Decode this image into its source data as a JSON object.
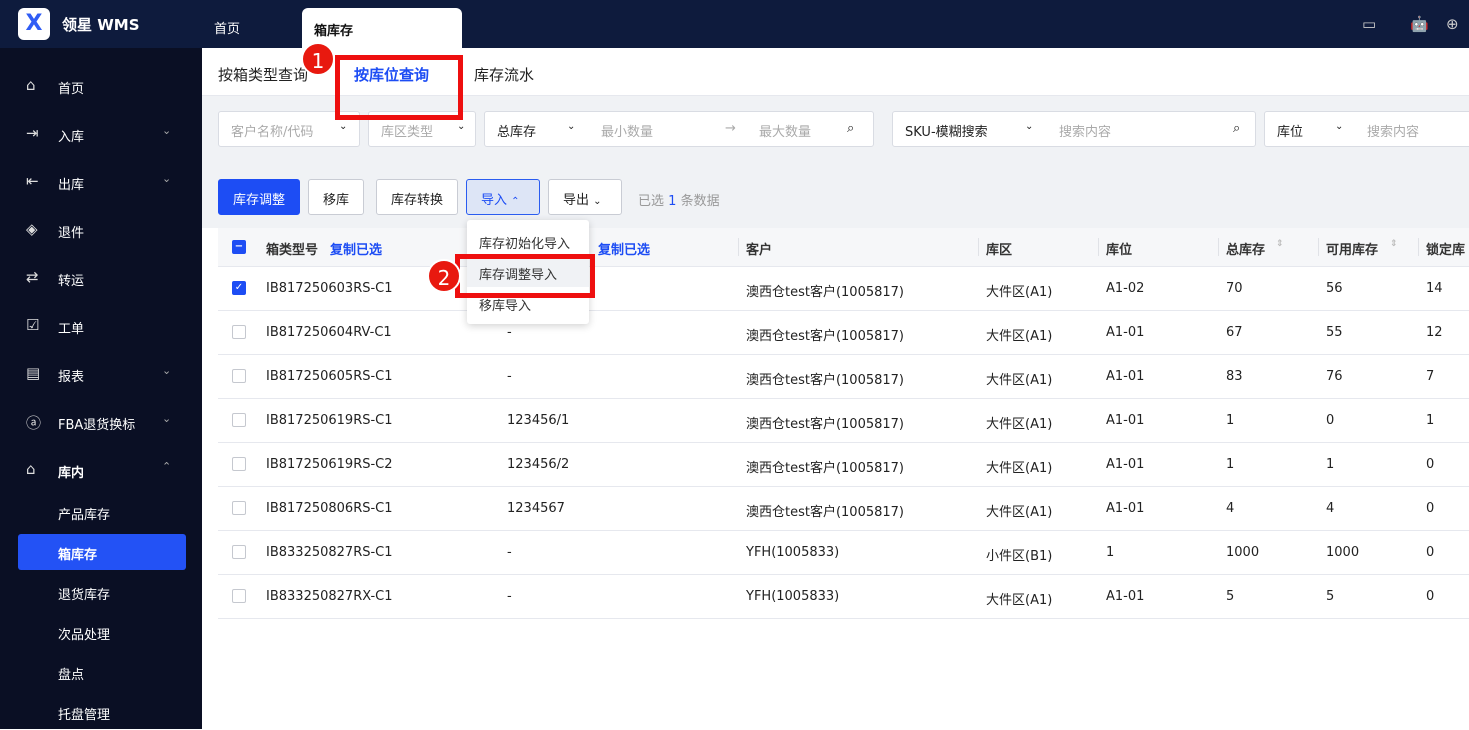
{
  "app": {
    "logo": "X",
    "name": "领星 WMS"
  },
  "topTabs": [
    {
      "label": "首页"
    },
    {
      "label": "箱库存"
    }
  ],
  "sidebar": {
    "items": [
      {
        "label": "首页",
        "icon": "home-icon"
      },
      {
        "label": "入库",
        "icon": "inbound-icon"
      },
      {
        "label": "出库",
        "icon": "outbound-icon"
      },
      {
        "label": "退件",
        "icon": "return-icon"
      },
      {
        "label": "转运",
        "icon": "transfer-icon"
      },
      {
        "label": "工单",
        "icon": "workorder-icon"
      },
      {
        "label": "报表",
        "icon": "report-icon"
      },
      {
        "label": "FBA退货换标",
        "icon": "amazon-icon"
      },
      {
        "label": "库内",
        "icon": "warehouse-icon"
      }
    ],
    "sub": [
      {
        "label": "产品库存"
      },
      {
        "label": "箱库存"
      },
      {
        "label": "退货库存"
      },
      {
        "label": "次品处理"
      },
      {
        "label": "盘点"
      },
      {
        "label": "托盘管理"
      }
    ]
  },
  "subTabs": [
    {
      "label": "按箱类型查询"
    },
    {
      "label": "按库位查询"
    },
    {
      "label": "库存流水"
    }
  ],
  "filters": {
    "customer": "客户名称/代码",
    "zoneType": "库区类型",
    "stockType": "总库存",
    "min": "最小数量",
    "arrow": "→",
    "max": "最大数量",
    "skuMode": "SKU-模糊搜索",
    "skuSearch": "搜索内容",
    "locMode": "库位",
    "locSearch": "搜索内容"
  },
  "toolbar": {
    "adjust": "库存调整",
    "move": "移库",
    "convert": "库存转换",
    "import": "导入",
    "export": "导出",
    "selPre": "已选",
    "selCount": "1",
    "selPost": "条数据"
  },
  "importMenu": [
    "库存初始化导入",
    "库存调整导入",
    "移库导入"
  ],
  "table": {
    "headers": {
      "boxType": "箱类型号",
      "copy1": "复制已选",
      "copy2": "复制已选",
      "customer": "客户",
      "zone": "库区",
      "location": "库位",
      "total": "总库存",
      "available": "可用库存",
      "locked": "锁定库"
    },
    "rows": [
      {
        "checked": true,
        "box": "IB817250603RS-C1",
        "col2": "",
        "customer": "澳西仓test客户(1005817)",
        "zone": "大件区(A1)",
        "loc": "A1-02",
        "total": "70",
        "avail": "56",
        "locked": "14"
      },
      {
        "checked": false,
        "box": "IB817250604RV-C1",
        "col2": "-",
        "customer": "澳西仓test客户(1005817)",
        "zone": "大件区(A1)",
        "loc": "A1-01",
        "total": "67",
        "avail": "55",
        "locked": "12"
      },
      {
        "checked": false,
        "box": "IB817250605RS-C1",
        "col2": "-",
        "customer": "澳西仓test客户(1005817)",
        "zone": "大件区(A1)",
        "loc": "A1-01",
        "total": "83",
        "avail": "76",
        "locked": "7"
      },
      {
        "checked": false,
        "box": "IB817250619RS-C1",
        "col2": "123456/1",
        "customer": "澳西仓test客户(1005817)",
        "zone": "大件区(A1)",
        "loc": "A1-01",
        "total": "1",
        "avail": "0",
        "locked": "1"
      },
      {
        "checked": false,
        "box": "IB817250619RS-C2",
        "col2": "123456/2",
        "customer": "澳西仓test客户(1005817)",
        "zone": "大件区(A1)",
        "loc": "A1-01",
        "total": "1",
        "avail": "1",
        "locked": "0"
      },
      {
        "checked": false,
        "box": "IB817250806RS-C1",
        "col2": "1234567",
        "customer": "澳西仓test客户(1005817)",
        "zone": "大件区(A1)",
        "loc": "A1-01",
        "total": "4",
        "avail": "4",
        "locked": "0"
      },
      {
        "checked": false,
        "box": "IB833250827RS-C1",
        "col2": "-",
        "customer": "YFH(1005833)",
        "zone": "小件区(B1)",
        "loc": "1",
        "total": "1000",
        "avail": "1000",
        "locked": "0"
      },
      {
        "checked": false,
        "box": "IB833250827RX-C1",
        "col2": "-",
        "customer": "YFH(1005833)",
        "zone": "大件区(A1)",
        "loc": "A1-01",
        "total": "5",
        "avail": "5",
        "locked": "0"
      }
    ]
  },
  "annotations": {
    "b1": "1",
    "b2": "2"
  },
  "colors": {
    "accent": "#1d4df4",
    "highlight": "#ee0f0f"
  }
}
